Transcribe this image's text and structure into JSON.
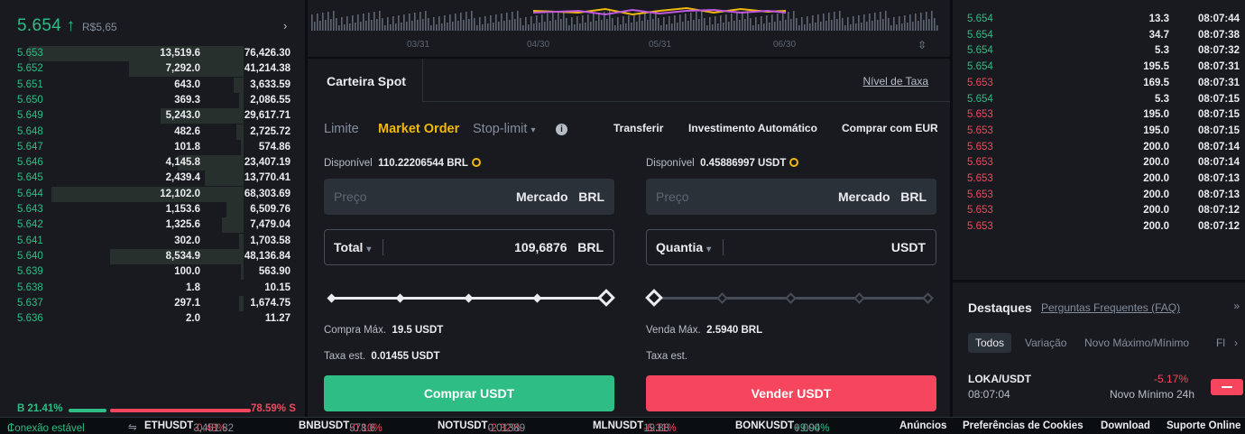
{
  "order_book": {
    "last_price": "5.654",
    "price_arrow": "↑",
    "fiat": "R$5,65",
    "more": "›",
    "bids": [
      {
        "price": "5.653",
        "amount": "13,519.6",
        "total": "76,426.30",
        "depth": 0.88
      },
      {
        "price": "5.652",
        "amount": "7,292.0",
        "total": "41,214.38",
        "depth": 0.47
      },
      {
        "price": "5.651",
        "amount": "643.0",
        "total": "3,633.59",
        "depth": 0.04
      },
      {
        "price": "5.650",
        "amount": "369.3",
        "total": "2,086.55",
        "depth": 0.02
      },
      {
        "price": "5.649",
        "amount": "5,243.0",
        "total": "29,617.71",
        "depth": 0.34
      },
      {
        "price": "5.648",
        "amount": "482.6",
        "total": "2,725.72",
        "depth": 0.03
      },
      {
        "price": "5.647",
        "amount": "101.8",
        "total": "574.86",
        "depth": 0.01
      },
      {
        "price": "5.646",
        "amount": "4,145.8",
        "total": "23,407.19",
        "depth": 0.27
      },
      {
        "price": "5.645",
        "amount": "2,439.4",
        "total": "13,770.41",
        "depth": 0.16
      },
      {
        "price": "5.644",
        "amount": "12,102.0",
        "total": "68,303.69",
        "depth": 0.79
      },
      {
        "price": "5.643",
        "amount": "1,153.6",
        "total": "6,509.76",
        "depth": 0.07
      },
      {
        "price": "5.642",
        "amount": "1,325.6",
        "total": "7,479.04",
        "depth": 0.09
      },
      {
        "price": "5.641",
        "amount": "302.0",
        "total": "1,703.58",
        "depth": 0.02
      },
      {
        "price": "5.640",
        "amount": "8,534.9",
        "total": "48,136.84",
        "depth": 0.55
      },
      {
        "price": "5.639",
        "amount": "100.0",
        "total": "563.90",
        "depth": 0.01
      },
      {
        "price": "5.638",
        "amount": "1.8",
        "total": "10.15",
        "depth": 0.0
      },
      {
        "price": "5.637",
        "amount": "297.1",
        "total": "1,674.75",
        "depth": 0.02
      },
      {
        "price": "5.636",
        "amount": "2.0",
        "total": "11.27",
        "depth": 0.0
      }
    ],
    "buy_ratio": "B 21.41%",
    "sell_ratio": "78.59% S",
    "buy_fraction": 0.2141
  },
  "chart_strip": {
    "dates": [
      "03/31",
      "04/30",
      "05/31",
      "06/30"
    ],
    "expand_icon": "⇳"
  },
  "spot": {
    "tab": "Carteira Spot",
    "fee_link": "Nível de Taxa",
    "order_types": [
      "Limite",
      "Market Order",
      "Stop-limit"
    ],
    "stop_caret": "▾",
    "info_icon": "i",
    "links": [
      "Transferir",
      "Investimento Automático",
      "Comprar com EUR"
    ],
    "buy": {
      "available_label": "Disponível",
      "available_value": "110.22206544 BRL",
      "price_placeholder": "Preço",
      "price_mode": "Mercado",
      "price_unit": "BRL",
      "total_label": "Total",
      "total_value": "109,6876",
      "total_unit": "BRL",
      "slider_value": 1.0,
      "max_label": "Compra Máx.",
      "max_value": "19.5 USDT",
      "fee_label": "Taxa est.",
      "fee_value": "0.01455 USDT",
      "button": "Comprar USDT"
    },
    "sell": {
      "available_label": "Disponível",
      "available_value": "0.45886997 USDT",
      "price_placeholder": "Preço",
      "price_mode": "Mercado",
      "price_unit": "BRL",
      "qty_label": "Quantia",
      "qty_unit": "USDT",
      "slider_value": 0.0,
      "max_label": "Venda Máx.",
      "max_value": "2.5940 BRL",
      "fee_label": "Taxa est.",
      "button": "Vender USDT"
    }
  },
  "trades": [
    {
      "price": "5.654",
      "amount": "13.3",
      "time": "08:07:44",
      "side": "buy"
    },
    {
      "price": "5.654",
      "amount": "34.7",
      "time": "08:07:38",
      "side": "buy"
    },
    {
      "price": "5.654",
      "amount": "5.3",
      "time": "08:07:32",
      "side": "buy"
    },
    {
      "price": "5.654",
      "amount": "195.5",
      "time": "08:07:31",
      "side": "buy"
    },
    {
      "price": "5.653",
      "amount": "169.5",
      "time": "08:07:31",
      "side": "sell"
    },
    {
      "price": "5.654",
      "amount": "5.3",
      "time": "08:07:15",
      "side": "buy"
    },
    {
      "price": "5.653",
      "amount": "195.0",
      "time": "08:07:15",
      "side": "sell"
    },
    {
      "price": "5.653",
      "amount": "195.0",
      "time": "08:07:15",
      "side": "sell"
    },
    {
      "price": "5.653",
      "amount": "200.0",
      "time": "08:07:14",
      "side": "sell"
    },
    {
      "price": "5.653",
      "amount": "200.0",
      "time": "08:07:14",
      "side": "sell"
    },
    {
      "price": "5.653",
      "amount": "200.0",
      "time": "08:07:13",
      "side": "sell"
    },
    {
      "price": "5.653",
      "amount": "200.0",
      "time": "08:07:13",
      "side": "sell"
    },
    {
      "price": "5.653",
      "amount": "200.0",
      "time": "08:07:12",
      "side": "sell"
    },
    {
      "price": "5.653",
      "amount": "200.0",
      "time": "08:07:12",
      "side": "sell"
    }
  ],
  "highlights": {
    "title": "Destaques",
    "faq": "Perguntas Frequentes (FAQ)",
    "collapse_icon": "»",
    "filters": [
      "Todos",
      "Variação",
      "Novo Máximo/Mínimo",
      "Fl"
    ],
    "filter_more": "›",
    "item": {
      "symbol": "LOKA/USDT",
      "time": "08:07:04",
      "change": "-5.17%",
      "event": "Novo Mínimo 24h"
    }
  },
  "footer": {
    "connection": "Conexão estável",
    "tickers": [
      {
        "sym": "ETHUSDT",
        "chg": "-0.48%",
        "price": "3,451.82",
        "dir": "r"
      },
      {
        "sym": "BNBUSDT",
        "chg": "-0.10%",
        "price": "578.6",
        "dir": "r"
      },
      {
        "sym": "NOTUSDT",
        "chg": "-2.32%",
        "price": "0.01389",
        "dir": "r"
      },
      {
        "sym": "MLNUSDT",
        "chg": "-6.31%",
        "price": "19.88",
        "dir": "r"
      },
      {
        "sym": "BONKUSDT",
        "chg": "+9.94%",
        "price": "0.000",
        "dir": "g"
      }
    ],
    "links": [
      "Anúncios",
      "Preferências de Cookies",
      "Download",
      "Suporte Online"
    ]
  },
  "colors": {
    "buy": "#2ebd85",
    "sell": "#f6465d",
    "accent": "#f0b90b"
  }
}
